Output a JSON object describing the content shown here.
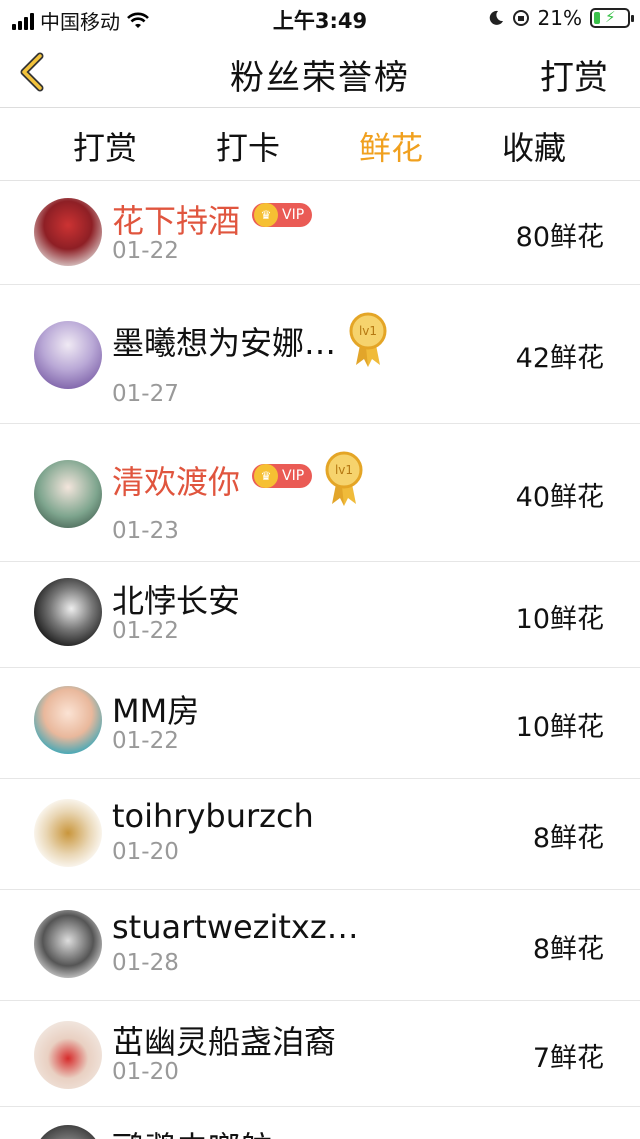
{
  "status_bar": {
    "carrier": "中国移动",
    "time": "上午3:49",
    "battery": "21%",
    "battery_level": 0.21
  },
  "nav": {
    "title": "粉丝荣誉榜",
    "right_action": "打赏"
  },
  "tabs": [
    {
      "label": "打赏",
      "active": false
    },
    {
      "label": "打卡",
      "active": false
    },
    {
      "label": "鲜花",
      "active": true
    },
    {
      "label": "收藏",
      "active": false
    }
  ],
  "colors": {
    "accent": "#f0a01e",
    "vip_name": "#e0553e",
    "vip_badge": "#ea5b55"
  },
  "vip_badge_label": "VIP",
  "level_badge_label": "lv1",
  "entries": [
    {
      "name": "花下持酒",
      "date": "01-22",
      "count": "80鲜花",
      "vip": true,
      "level": false
    },
    {
      "name": "墨曦想为安娜…",
      "date": "01-27",
      "count": "42鲜花",
      "vip": false,
      "level": true
    },
    {
      "name": "清欢渡你",
      "date": "01-23",
      "count": "40鲜花",
      "vip": true,
      "level": true
    },
    {
      "name": "北悖长安",
      "date": "01-22",
      "count": "10鲜花",
      "vip": false,
      "level": false
    },
    {
      "name": "MM房",
      "date": "01-22",
      "count": "10鲜花",
      "vip": false,
      "level": false
    },
    {
      "name": "toihryburzch",
      "date": "01-20",
      "count": "8鲜花",
      "vip": false,
      "level": false
    },
    {
      "name": "stuartwezitxz…",
      "date": "01-28",
      "count": "8鲜花",
      "vip": false,
      "level": false
    },
    {
      "name": "茁幽灵船盏洎裔",
      "date": "01-20",
      "count": "7鲜花",
      "vip": false,
      "level": false
    },
    {
      "name": "鹂鹉史啷舫",
      "date": "",
      "count": "",
      "vip": false,
      "level": false
    }
  ]
}
